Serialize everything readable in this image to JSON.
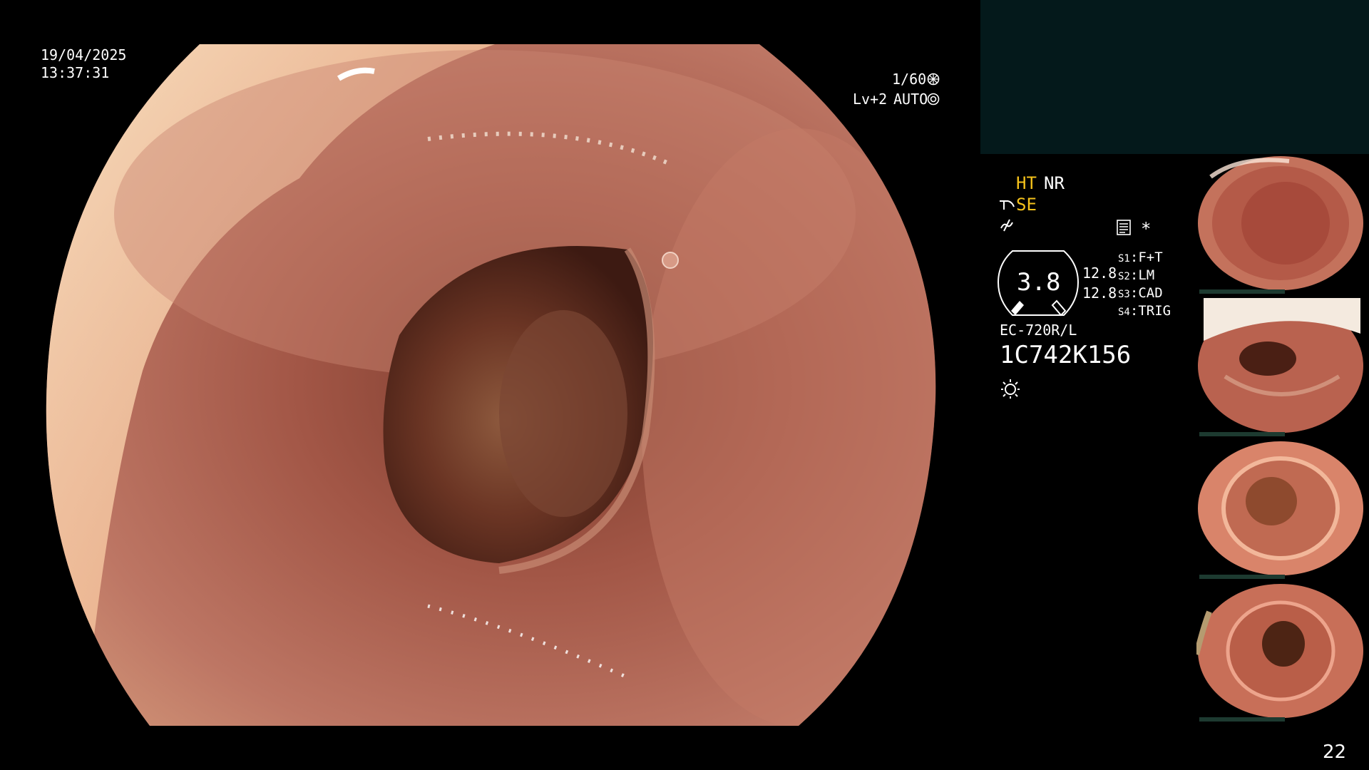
{
  "main_view": {
    "date": "19/04/2025",
    "time": "13:37:31",
    "shutter": "1/60",
    "level": "Lv+2",
    "iris": "AUTO"
  },
  "settings": {
    "ht": "HT",
    "nr": "NR",
    "se": "SE",
    "zoom": "3.8",
    "values": [
      "12.8",
      "12.8"
    ],
    "switches": [
      {
        "key": "S1",
        "value": "F+T"
      },
      {
        "key": "S2",
        "value": "LM"
      },
      {
        "key": "S3",
        "value": "CAD"
      },
      {
        "key": "S4",
        "value": "TRIG"
      }
    ],
    "scope_model": "EC-720R/L",
    "serial": "1C742K156"
  },
  "page_number": "22",
  "colors": {
    "status_panel": "#04191b",
    "accent_yellow": "#f5c21b",
    "mucosa": "#b86a5a"
  },
  "icons": [
    "shutter-icon",
    "iris-icon",
    "structure-enhance-icon",
    "waveform-icon",
    "record-icon",
    "asterisk-icon",
    "light-icon"
  ]
}
